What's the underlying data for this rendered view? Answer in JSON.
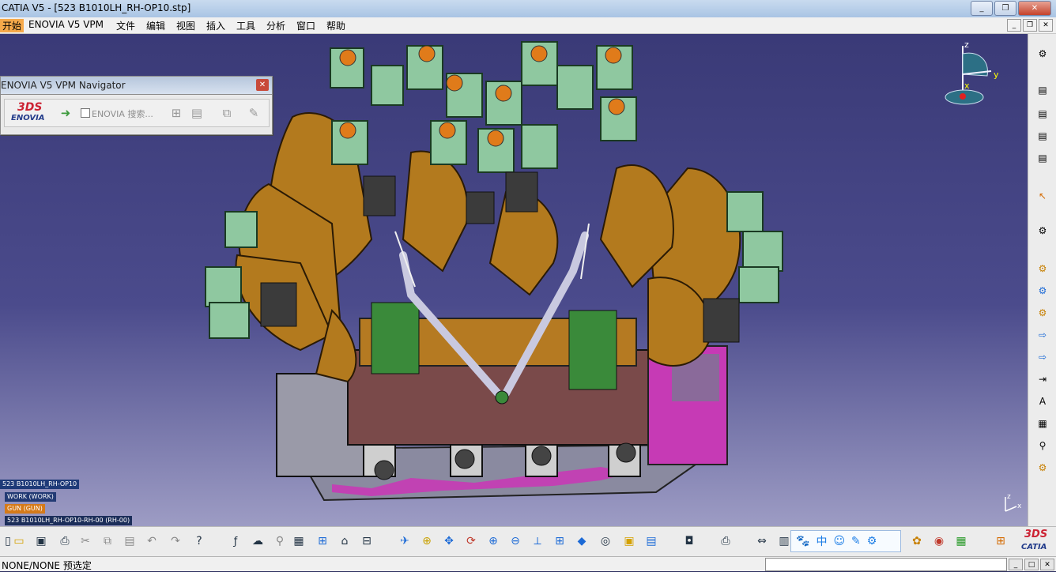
{
  "window": {
    "title": "CATIA V5 - [523 B1010LH_RH-OP10.stp]",
    "minimize": "_",
    "maximize": "❐",
    "close": "✕"
  },
  "menubar": {
    "items": [
      "开始",
      "ENOVIA V5 VPM",
      "文件",
      "编辑",
      "视图",
      "插入",
      "工具",
      "分析",
      "窗口",
      "帮助"
    ],
    "mdi_minimize": "_",
    "mdi_restore": "❐",
    "mdi_close": "✕"
  },
  "navigator": {
    "title": "ENOVIA V5 VPM Navigator",
    "close": "✕",
    "logo_mark": "3DS",
    "logo_text": "ENOVIA",
    "search_label": "ENOVIA 搜索..."
  },
  "compass": {
    "z_label": "z",
    "y_label": "y",
    "x_label": "x"
  },
  "tree": {
    "nodes": [
      {
        "label": "523 B1010LH_RH-OP10"
      },
      {
        "label": "WORK (WORK)"
      },
      {
        "label": "GUN (GUN)"
      },
      {
        "label": "523 B1010LH_RH-OP10-RH-00 (RH-00)"
      }
    ]
  },
  "mini_axis": {
    "z_label": "z",
    "x_label": "x"
  },
  "ime": {
    "paw_icon": "🐾",
    "lang": "中",
    "emoji": "☺",
    "pen": "✎",
    "gear": "⚙"
  },
  "bottom_logo": {
    "mark": "3DS",
    "text": "CATIA"
  },
  "status": {
    "text": "NONE/NONE 预选定",
    "win_min": "_",
    "win_max": "□",
    "win_close": "✕"
  },
  "colors": {
    "viewport_top": "#3a3a77",
    "viewport_bottom": "#9d9cc4",
    "menu_active": "#f6a94a",
    "model_orange": "#b37a1e",
    "model_green": "#8fc8a0",
    "model_magenta": "#c63ab5"
  },
  "icons": {
    "right_toolbar": [
      "compass-gear-icon",
      "stack-icon",
      "stack-icon",
      "stack-icon",
      "stack-icon",
      "select-arrow-icon",
      "settings-arrow-icon",
      "gear-icon",
      "gear-icon",
      "gear-icon",
      "move-icon",
      "move-icon",
      "measure-icon",
      "text-icon",
      "table-icon",
      "tree-icon"
    ],
    "bottom_toolbar": [
      "new-icon",
      "open-icon",
      "save-icon",
      "print-icon",
      "cut-icon",
      "copy-icon",
      "paste-icon",
      "undo-icon",
      "redo-icon",
      "help-icon",
      "formula-icon",
      "comment-icon",
      "knowledge-icon",
      "table-icon",
      "tree-icon",
      "lock-icon",
      "graph-icon",
      "fly-icon",
      "fit-all-icon",
      "pan-icon",
      "rotate-icon",
      "zoom-in-icon",
      "zoom-out-icon",
      "normal-view-icon",
      "views-icon",
      "iso-view-icon",
      "render-icon",
      "hide-icon",
      "swap-icon",
      "camera-icon",
      "capture-icon",
      "measure-icon",
      "analysis-icon"
    ]
  }
}
